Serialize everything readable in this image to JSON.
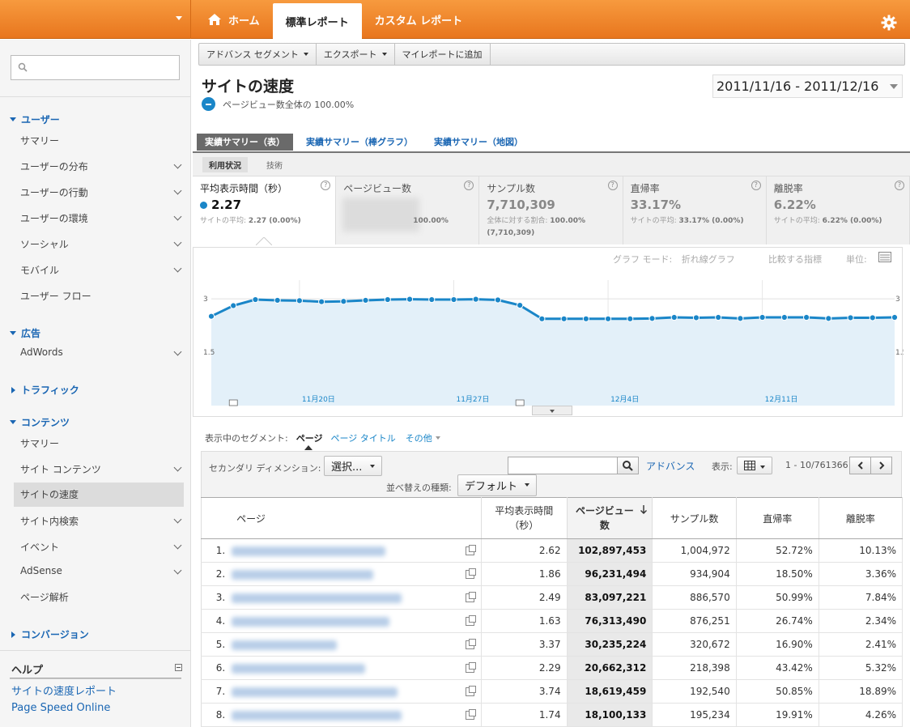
{
  "topnav": {
    "tabs": [
      {
        "label": "ホーム",
        "active": false
      },
      {
        "label": "標準レポート",
        "active": true
      },
      {
        "label": "カスタム レポート",
        "active": false
      }
    ]
  },
  "sidebar": {
    "search_value": "",
    "sections": {
      "users": {
        "label": "ユーザー",
        "items": [
          "サマリー",
          "ユーザーの分布",
          "ユーザーの行動",
          "ユーザーの環境",
          "ソーシャル",
          "モバイル",
          "ユーザー フロー"
        ]
      },
      "ads": {
        "label": "広告",
        "items": [
          "AdWords"
        ]
      },
      "traffic": {
        "label": "トラフィック"
      },
      "content": {
        "label": "コンテンツ",
        "items": [
          "サマリー",
          "サイト コンテンツ",
          "サイトの速度",
          "サイト内検索",
          "イベント",
          "AdSense",
          "ページ解析"
        ],
        "selected": "サイトの速度"
      },
      "conversion": {
        "label": "コンバージョン"
      }
    },
    "help": {
      "title": "ヘルプ",
      "links": [
        "サイトの速度レポート",
        "Page Speed Online"
      ]
    }
  },
  "toolbar": {
    "buttons": [
      "アドバンス セグメント",
      "エクスポート",
      "マイレポートに追加"
    ]
  },
  "report": {
    "title": "サイトの速度",
    "segment_text": "ページビュー数全体の 100.00%",
    "date_range": "2011/11/16 - 2011/12/16"
  },
  "view_tabs": [
    "実績サマリー（表）",
    "実績サマリー（棒グラフ）",
    "実績サマリー（地図）"
  ],
  "sub_tabs": [
    "利用状況",
    "技術"
  ],
  "scorecards": [
    {
      "name": "平均表示時間（秒）",
      "value": "2.27",
      "sub": "サイトの平均:",
      "sub_val": "2.27 (0.00%)"
    },
    {
      "name": "ページビュー数",
      "value": "",
      "sub": "",
      "sub_val": "100.00%"
    },
    {
      "name": "サンプル数",
      "value": "7,710,309",
      "sub": "全体に対する割合:",
      "sub_val": "100.00% (7,710,309)"
    },
    {
      "name": "直帰率",
      "value": "33.17%",
      "sub": "サイトの平均:",
      "sub_val": "33.17% (0.00%)"
    },
    {
      "name": "離脱率",
      "value": "6.22%",
      "sub": "サイトの平均:",
      "sub_val": "6.22% (0.00%)"
    }
  ],
  "graph_options": {
    "mode_label": "グラフ モード:",
    "mode_value": "折れ線グラフ",
    "compare": "比較する指標",
    "unit": "単位:"
  },
  "chart_data": {
    "type": "area",
    "series": [
      {
        "name": "平均表示時間（秒）",
        "values": [
          2.51,
          2.81,
          2.98,
          2.96,
          2.95,
          2.92,
          2.93,
          2.96,
          2.98,
          2.99,
          2.98,
          2.98,
          2.99,
          2.97,
          2.82,
          2.44,
          2.44,
          2.44,
          2.44,
          2.44,
          2.45,
          2.48,
          2.47,
          2.48,
          2.45,
          2.48,
          2.48,
          2.48,
          2.45,
          2.47,
          2.47,
          2.48
        ]
      }
    ],
    "x": [
      "2011/11/16",
      "2011/11/17",
      "2011/11/18",
      "2011/11/19",
      "2011/11/20",
      "2011/11/21",
      "2011/11/22",
      "2011/11/23",
      "2011/11/24",
      "2011/11/25",
      "2011/11/26",
      "2011/11/27",
      "2011/11/28",
      "2011/11/29",
      "2011/11/30",
      "2011/12/01",
      "2011/12/02",
      "2011/12/03",
      "2011/12/04",
      "2011/12/05",
      "2011/12/06",
      "2011/12/07",
      "2011/12/08",
      "2011/12/09",
      "2011/12/10",
      "2011/12/11",
      "2011/12/12",
      "2011/12/13",
      "2011/12/14",
      "2011/12/15",
      "2011/12/16"
    ],
    "x_tick_labels": [
      "11月20日",
      "11月27日",
      "12月4日",
      "12月11日"
    ],
    "y_tick_labels": [
      "3",
      "1.5"
    ],
    "ylim": [
      0,
      3.3
    ],
    "color": "#1a86c8",
    "fill": "#e3f0f9"
  },
  "segments": {
    "label": "表示中のセグメント:",
    "current": "ページ",
    "others": [
      "ページ タイトル"
    ],
    "more": "その他"
  },
  "controls": {
    "secondary_dim_label": "セカンダリ ディメンション:",
    "secondary_dim_value": "選択...",
    "sort_label": "並べ替えの種類:",
    "sort_value": "デフォルト",
    "advanced": "アドバンス",
    "display_label": "表示:",
    "pager": "1 - 10/761366"
  },
  "table": {
    "headers": [
      "ページ",
      "平均表示時間（秒）",
      "ページビュー数",
      "サンプル数",
      "直帰率",
      "離脱率"
    ],
    "rows": [
      {
        "n": "1.",
        "time": "2.62",
        "pv": "102,897,453",
        "samples": "1,004,972",
        "bounce": "52.72%",
        "exit": "10.13%"
      },
      {
        "n": "2.",
        "time": "1.86",
        "pv": "96,231,494",
        "samples": "934,904",
        "bounce": "18.50%",
        "exit": "3.36%"
      },
      {
        "n": "3.",
        "time": "2.49",
        "pv": "83,097,221",
        "samples": "886,570",
        "bounce": "50.99%",
        "exit": "7.84%"
      },
      {
        "n": "4.",
        "time": "1.63",
        "pv": "76,313,490",
        "samples": "876,251",
        "bounce": "26.74%",
        "exit": "2.34%"
      },
      {
        "n": "5.",
        "time": "3.37",
        "pv": "30,235,224",
        "samples": "320,672",
        "bounce": "16.90%",
        "exit": "2.41%"
      },
      {
        "n": "6.",
        "time": "2.29",
        "pv": "20,662,312",
        "samples": "218,398",
        "bounce": "43.42%",
        "exit": "5.32%"
      },
      {
        "n": "7.",
        "time": "3.74",
        "pv": "18,619,459",
        "samples": "192,540",
        "bounce": "50.85%",
        "exit": "18.89%"
      },
      {
        "n": "8.",
        "time": "1.74",
        "pv": "18,100,133",
        "samples": "195,234",
        "bounce": "19.91%",
        "exit": "4.26%"
      }
    ]
  }
}
